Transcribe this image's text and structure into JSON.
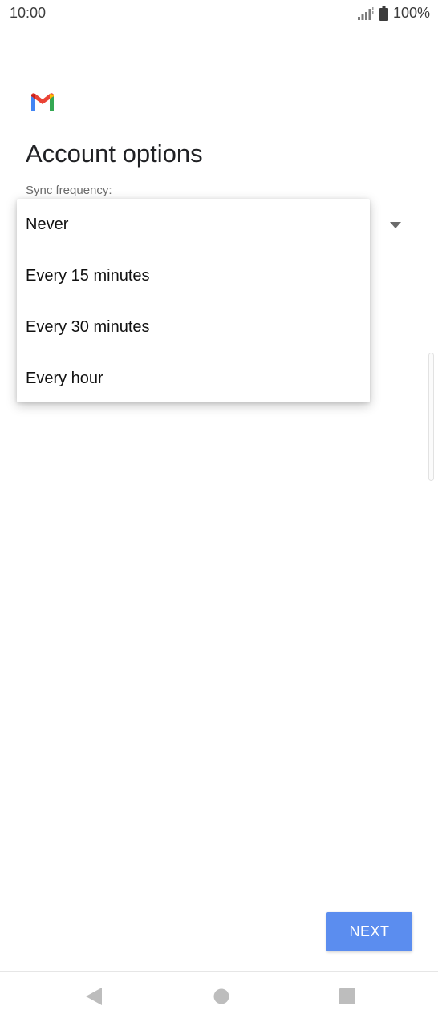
{
  "status_bar": {
    "time": "10:00",
    "battery": "100%",
    "icons": [
      "signal-icon",
      "battery-icon"
    ]
  },
  "app": {
    "logo": "gmail-logo-icon",
    "colors": {
      "red": "#EA4335",
      "blue": "#4285F4",
      "green": "#34A853",
      "yellow": "#FBBC04"
    }
  },
  "page": {
    "title": "Account options",
    "sync_label": "Sync frequency:"
  },
  "dropdown": {
    "options": [
      "Never",
      "Every 15 minutes",
      "Every 30 minutes",
      "Every hour"
    ]
  },
  "actions": {
    "next_label": "NEXT",
    "next_color": "#5B8DEF"
  },
  "nav": {
    "icons": [
      "back-icon",
      "home-icon",
      "recents-icon"
    ]
  }
}
